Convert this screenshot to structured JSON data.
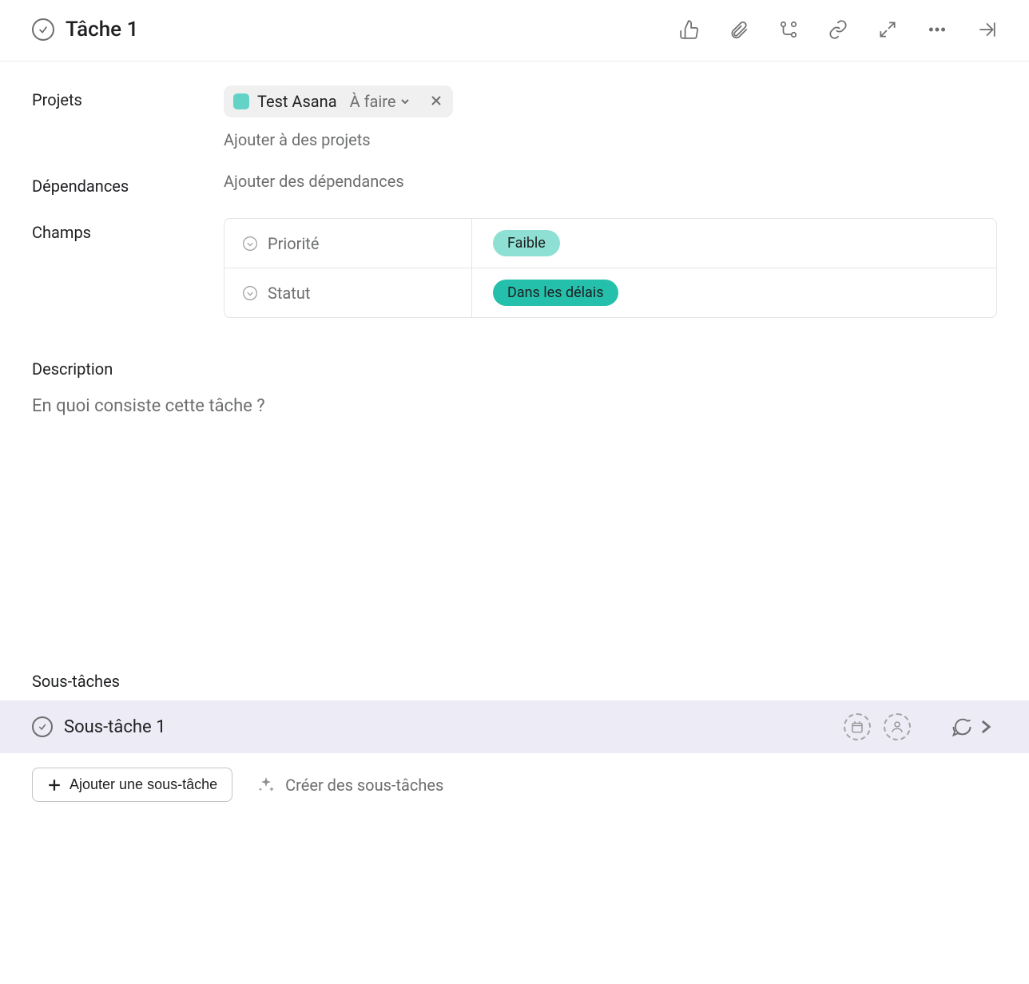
{
  "header": {
    "task_title": "Tâche 1"
  },
  "fields": {
    "projects_label": "Projets",
    "project_name": "Test Asana",
    "project_section": "À faire",
    "add_to_projects": "Ajouter à des projets",
    "dependencies_label": "Dépendances",
    "add_dependencies": "Ajouter des dépendances",
    "custom_fields_label": "Champs",
    "custom_fields": [
      {
        "name": "Priorité",
        "value": "Faible",
        "pill_class": "pill-light"
      },
      {
        "name": "Statut",
        "value": "Dans les délais",
        "pill_class": "pill-dark"
      }
    ]
  },
  "description": {
    "label": "Description",
    "placeholder": "En quoi consiste cette tâche ?"
  },
  "subtasks": {
    "label": "Sous-tâches",
    "items": [
      {
        "name": "Sous-tâche 1"
      }
    ],
    "add_button": "Ajouter une sous-tâche",
    "ai_button": "Créer des sous-tâches"
  }
}
